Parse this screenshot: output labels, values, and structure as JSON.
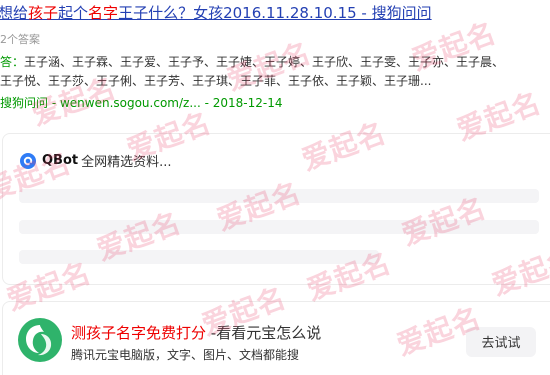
{
  "result": {
    "title_parts": [
      "想给",
      "孩子",
      "起个",
      "名字",
      "王子什么？女孩2016.11.28.10.15 - 搜狗问问"
    ],
    "answer_count": "2个答案",
    "answer_prefix": "答：",
    "answer_line1": "王子涵、王子霖、王子爱、王子予、王子婕、王子婷、王子欣、王子雯、王子亦、王子晨、",
    "answer_line2": "王子悦、王子莎、王子俐、王子芳、王子琪、王子菲、王子依、王子颖、王子珊...",
    "source": "搜狗问问 - wenwen.sogou.com/z... - 2018-12-14"
  },
  "qbot": {
    "name": "QBot",
    "status_text": "全网精选资料...",
    "logo_color": "#2f7cf6"
  },
  "ad": {
    "title_highlight": "测孩子名字免费打分",
    "title_rest": " -看看元宝怎么说",
    "description": "腾讯元宝电脑版，文字、图片、文档都能搜",
    "button_label": "去试试",
    "logo_icon": "yuanbao-logo-icon",
    "logo_color": "#2fb36b"
  },
  "watermark_text": "爱起名",
  "colors": {
    "link": "#2440b3",
    "highlight": "#ee0000",
    "green": "#009900",
    "watermark": "#e83c64"
  }
}
